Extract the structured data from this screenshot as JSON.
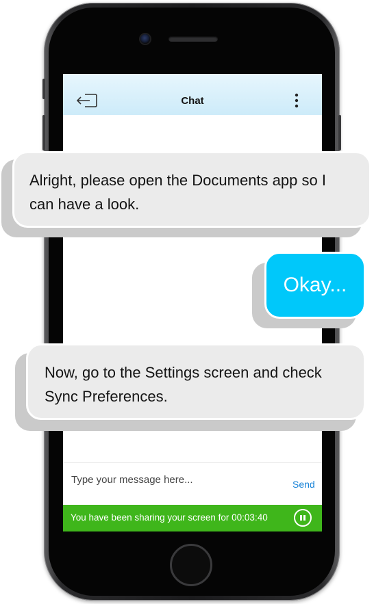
{
  "header": {
    "title": "Chat",
    "back_icon": "back-arrow-icon",
    "menu_icon": "more-vertical-icon"
  },
  "composer": {
    "placeholder": "Type your message here...",
    "send_label": "Send"
  },
  "share_bar": {
    "text": "You have been sharing your screen for 00:03:40",
    "pause_icon": "pause-icon"
  },
  "messages": [
    {
      "sender": "agent",
      "text": "Alright, please open the Documents app so I can have a look."
    },
    {
      "sender": "user",
      "text": "Okay..."
    },
    {
      "sender": "agent",
      "text": "Now, go to the Settings screen and check Sync Preferences."
    }
  ],
  "colors": {
    "header_bg": "#d6eff9",
    "share_bar": "#3fb61b",
    "user_bubble": "#00c8fa",
    "agent_bubble": "#ebebeb",
    "send_link": "#1a84d8"
  }
}
